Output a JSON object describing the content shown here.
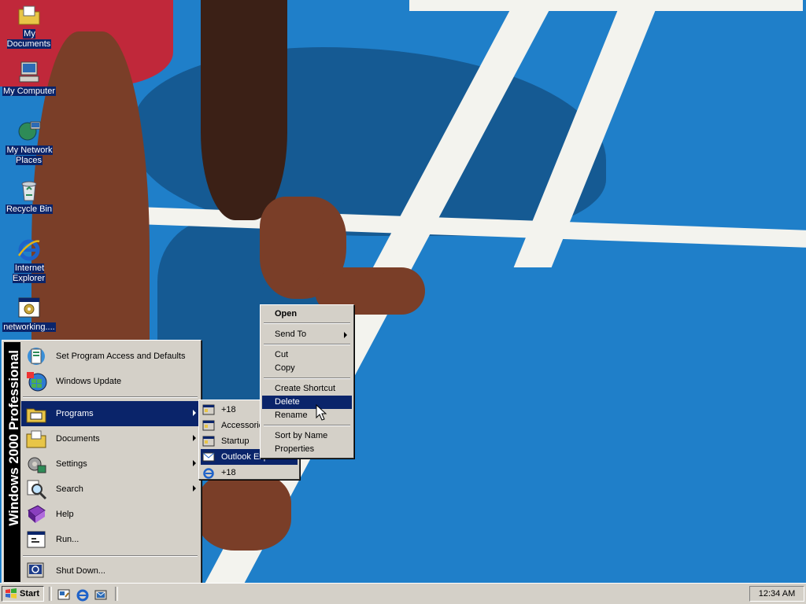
{
  "desktop": {
    "icons": [
      {
        "label": "My Documents",
        "icon": "folder-documents-icon"
      },
      {
        "label": "My Computer",
        "icon": "computer-icon"
      },
      {
        "label": "My Network Places",
        "icon": "network-places-icon"
      },
      {
        "label": "Recycle Bin",
        "icon": "recycle-bin-icon"
      },
      {
        "label": "Internet Explorer",
        "icon": "internet-explorer-icon"
      },
      {
        "label": "networking....",
        "icon": "setup-program-icon"
      }
    ]
  },
  "start_menu": {
    "banner": "Windows 2000 Professional",
    "items": [
      {
        "label": "Set Program Access and Defaults",
        "icon": "program-access-icon",
        "submenu": false
      },
      {
        "label": "Windows Update",
        "icon": "windows-update-icon",
        "submenu": false
      },
      {
        "label": "Programs",
        "icon": "programs-icon",
        "submenu": true,
        "selected": true
      },
      {
        "label": "Documents",
        "icon": "documents-icon",
        "submenu": true
      },
      {
        "label": "Settings",
        "icon": "settings-icon",
        "submenu": true
      },
      {
        "label": "Search",
        "icon": "search-icon",
        "submenu": true
      },
      {
        "label": "Help",
        "icon": "help-icon",
        "submenu": false
      },
      {
        "label": "Run...",
        "icon": "run-icon",
        "submenu": false
      },
      {
        "label": "Shut Down...",
        "icon": "shutdown-icon",
        "submenu": false
      }
    ]
  },
  "programs_submenu": {
    "items": [
      {
        "label": "+18",
        "icon": "program-group-icon"
      },
      {
        "label": "Accessories",
        "icon": "program-group-icon"
      },
      {
        "label": "Startup",
        "icon": "program-group-icon"
      },
      {
        "label": "Outlook Express",
        "icon": "outlook-express-icon",
        "selected": true
      },
      {
        "label": "+18",
        "icon": "internet-explorer-icon"
      }
    ]
  },
  "context_menu": {
    "items": [
      {
        "label": "Open",
        "bold": true
      },
      {
        "label": "Send To",
        "submenu": true
      },
      {
        "label": "Cut"
      },
      {
        "label": "Copy"
      },
      {
        "label": "Create Shortcut"
      },
      {
        "label": "Delete",
        "selected": true
      },
      {
        "label": "Rename"
      },
      {
        "label": "Sort by Name"
      },
      {
        "label": "Properties"
      }
    ]
  },
  "taskbar": {
    "start_label": "Start",
    "quick_launch": [
      "show-desktop-icon",
      "internet-explorer-icon",
      "outlook-express-icon"
    ],
    "clock": "12:34 AM"
  },
  "colors": {
    "selection": "#0a246a",
    "menu_face": "#d4d0c8",
    "wallpaper_track": "#1f7fc9"
  }
}
